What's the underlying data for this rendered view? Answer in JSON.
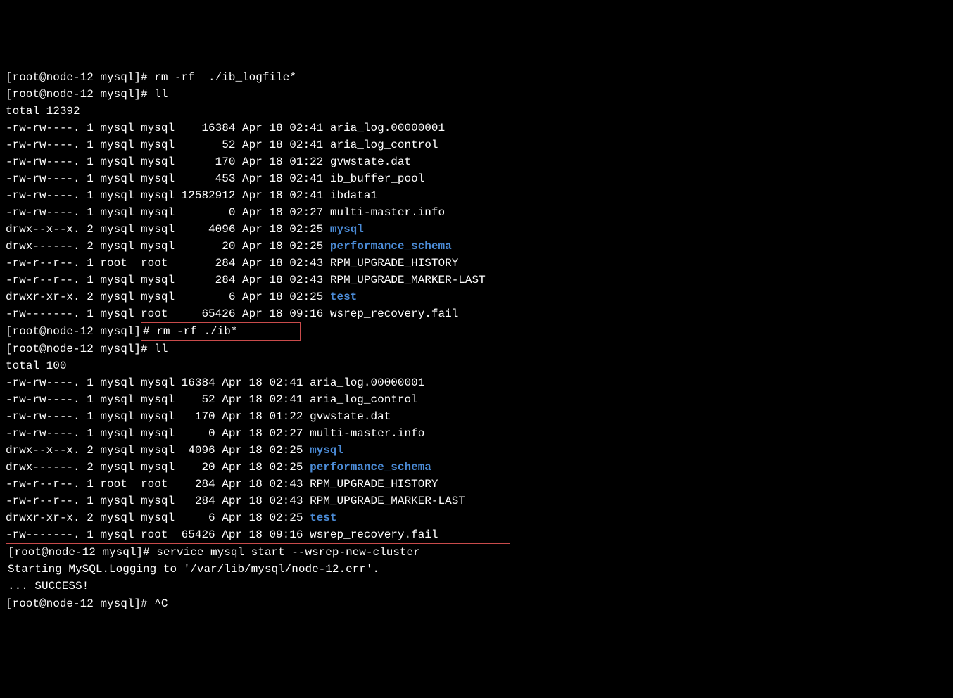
{
  "top_cmd_prefix": "[root@node-12 mysql]# rm -rf  ./ib_logfile*",
  "prompt1": "[root@node-12 mysql]# ll",
  "total1": "total 12392",
  "ls1": [
    {
      "perm": "-rw-rw----.",
      "n": "1",
      "own": "mysql",
      "grp": "mysql",
      "size": "   16384",
      "date": "Apr 18 02:41",
      "name": "aria_log.00000001",
      "dir": false
    },
    {
      "perm": "-rw-rw----.",
      "n": "1",
      "own": "mysql",
      "grp": "mysql",
      "size": "      52",
      "date": "Apr 18 02:41",
      "name": "aria_log_control",
      "dir": false
    },
    {
      "perm": "-rw-rw----.",
      "n": "1",
      "own": "mysql",
      "grp": "mysql",
      "size": "     170",
      "date": "Apr 18 01:22",
      "name": "gvwstate.dat",
      "dir": false
    },
    {
      "perm": "-rw-rw----.",
      "n": "1",
      "own": "mysql",
      "grp": "mysql",
      "size": "     453",
      "date": "Apr 18 02:41",
      "name": "ib_buffer_pool",
      "dir": false
    },
    {
      "perm": "-rw-rw----.",
      "n": "1",
      "own": "mysql",
      "grp": "mysql",
      "size": "12582912",
      "date": "Apr 18 02:41",
      "name": "ibdata1",
      "dir": false
    },
    {
      "perm": "-rw-rw----.",
      "n": "1",
      "own": "mysql",
      "grp": "mysql",
      "size": "       0",
      "date": "Apr 18 02:27",
      "name": "multi-master.info",
      "dir": false
    },
    {
      "perm": "drwx--x--x.",
      "n": "2",
      "own": "mysql",
      "grp": "mysql",
      "size": "    4096",
      "date": "Apr 18 02:25",
      "name": "mysql",
      "dir": true
    },
    {
      "perm": "drwx------.",
      "n": "2",
      "own": "mysql",
      "grp": "mysql",
      "size": "      20",
      "date": "Apr 18 02:25",
      "name": "performance_schema",
      "dir": true
    },
    {
      "perm": "-rw-r--r--.",
      "n": "1",
      "own": "root ",
      "grp": "root ",
      "size": "     284",
      "date": "Apr 18 02:43",
      "name": "RPM_UPGRADE_HISTORY",
      "dir": false
    },
    {
      "perm": "-rw-r--r--.",
      "n": "1",
      "own": "mysql",
      "grp": "mysql",
      "size": "     284",
      "date": "Apr 18 02:43",
      "name": "RPM_UPGRADE_MARKER-LAST",
      "dir": false
    },
    {
      "perm": "drwxr-xr-x.",
      "n": "2",
      "own": "mysql",
      "grp": "mysql",
      "size": "       6",
      "date": "Apr 18 02:25",
      "name": "test",
      "dir": true
    },
    {
      "perm": "-rw-------.",
      "n": "1",
      "own": "mysql",
      "grp": "root ",
      "size": "   65426",
      "date": "Apr 18 09:16",
      "name": "wsrep_recovery.fail",
      "dir": false
    }
  ],
  "rm_prompt_prefix": "[root@node-12 mysql]",
  "rm_cmd": "# rm -rf ./ib*",
  "prompt2": "[root@node-12 mysql]# ll",
  "total2": "total 100",
  "ls2": [
    {
      "perm": "-rw-rw----.",
      "n": "1",
      "own": "mysql",
      "grp": "mysql",
      "size": "16384",
      "date": "Apr 18 02:41",
      "name": "aria_log.00000001",
      "dir": false
    },
    {
      "perm": "-rw-rw----.",
      "n": "1",
      "own": "mysql",
      "grp": "mysql",
      "size": "   52",
      "date": "Apr 18 02:41",
      "name": "aria_log_control",
      "dir": false
    },
    {
      "perm": "-rw-rw----.",
      "n": "1",
      "own": "mysql",
      "grp": "mysql",
      "size": "  170",
      "date": "Apr 18 01:22",
      "name": "gvwstate.dat",
      "dir": false
    },
    {
      "perm": "-rw-rw----.",
      "n": "1",
      "own": "mysql",
      "grp": "mysql",
      "size": "    0",
      "date": "Apr 18 02:27",
      "name": "multi-master.info",
      "dir": false
    },
    {
      "perm": "drwx--x--x.",
      "n": "2",
      "own": "mysql",
      "grp": "mysql",
      "size": " 4096",
      "date": "Apr 18 02:25",
      "name": "mysql",
      "dir": true
    },
    {
      "perm": "drwx------.",
      "n": "2",
      "own": "mysql",
      "grp": "mysql",
      "size": "   20",
      "date": "Apr 18 02:25",
      "name": "performance_schema",
      "dir": true
    },
    {
      "perm": "-rw-r--r--.",
      "n": "1",
      "own": "root ",
      "grp": "root ",
      "size": "  284",
      "date": "Apr 18 02:43",
      "name": "RPM_UPGRADE_HISTORY",
      "dir": false
    },
    {
      "perm": "-rw-r--r--.",
      "n": "1",
      "own": "mysql",
      "grp": "mysql",
      "size": "  284",
      "date": "Apr 18 02:43",
      "name": "RPM_UPGRADE_MARKER-LAST",
      "dir": false
    },
    {
      "perm": "drwxr-xr-x.",
      "n": "2",
      "own": "mysql",
      "grp": "mysql",
      "size": "    6",
      "date": "Apr 18 02:25",
      "name": "test",
      "dir": true
    },
    {
      "perm": "-rw-------.",
      "n": "1",
      "own": "mysql",
      "grp": "root ",
      "size": "65426",
      "date": "Apr 18 09:16",
      "name": "wsrep_recovery.fail",
      "dir": false
    }
  ],
  "service_block": {
    "l1": "[root@node-12 mysql]# service mysql start --wsrep-new-cluster",
    "l2": "Starting MySQL.Logging to '/var/lib/mysql/node-12.err'.",
    "l3": "... SUCCESS!"
  },
  "last_prompt": "[root@node-12 mysql]# ^C"
}
